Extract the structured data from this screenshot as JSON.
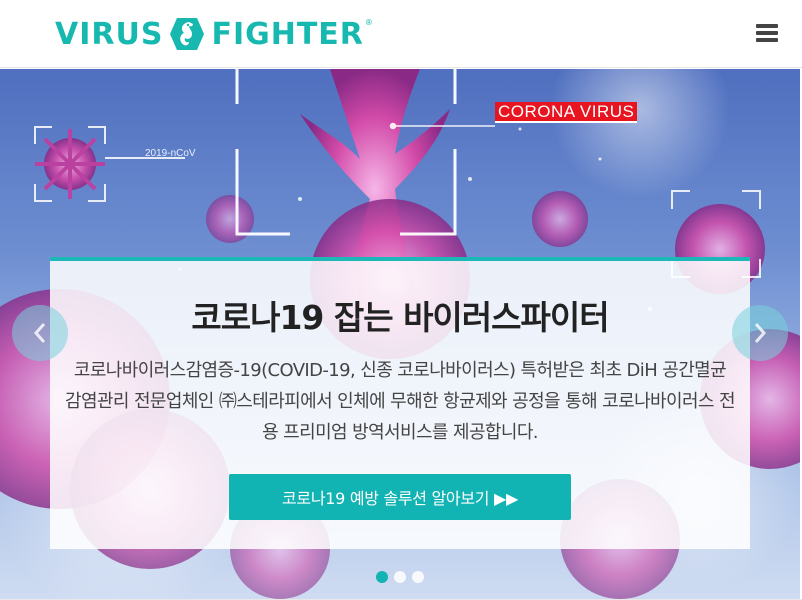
{
  "brand": {
    "logo_left": "VIRUS",
    "logo_right": "FIGHTER",
    "logo_registered": "®",
    "color": "#16b8b0"
  },
  "header": {
    "menu_icon": "hamburger-menu-icon"
  },
  "hero": {
    "corona_label": "CORONA VIRUS",
    "ncov_label": "2019-nCoV",
    "title": "코로나19 잡는 바이러스파이터",
    "description": "코로나바이러스감염증-19(COVID-19, 신종 코로나바이러스) 특허받은 최초 DiH 공간멸균 감염관리 전문업체인 ㈜스테라피에서 인체에 무해한 항균제와 공정을 통해 코로나바이러스 전용 프리미엄 방역서비스를 제공합니다.",
    "cta_label": "코로나19 예방 솔루션 알아보기 ▶▶",
    "prev_icon": "chevron-left-icon",
    "next_icon": "chevron-right-icon",
    "accent_color": "#12b3b3",
    "label_color": "#e8141f"
  },
  "slider": {
    "active_index": 0,
    "count": 3
  }
}
